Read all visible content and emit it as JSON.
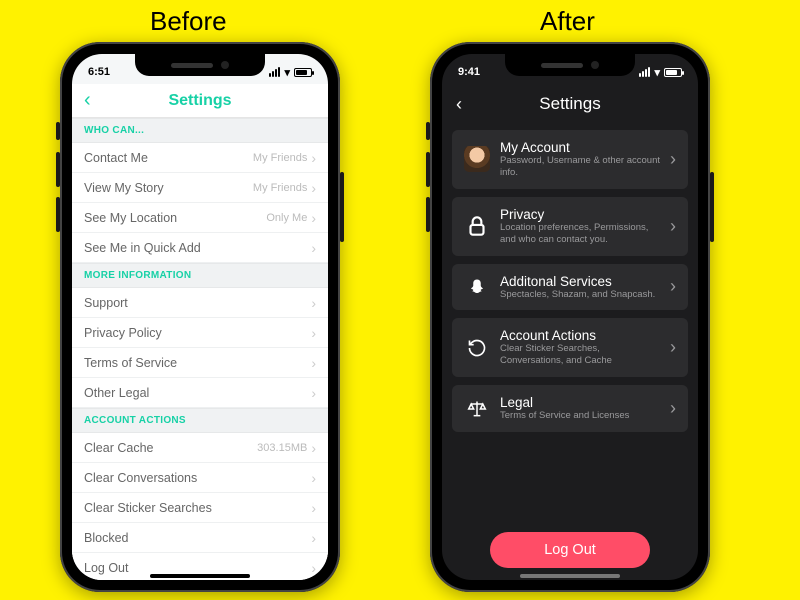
{
  "captions": {
    "before": "Before",
    "after": "After"
  },
  "before": {
    "status": {
      "time": "6:51"
    },
    "header": {
      "title": "Settings"
    },
    "sections": {
      "who_can": {
        "header": "WHO CAN...",
        "items": [
          {
            "label": "Contact Me",
            "value": "My Friends"
          },
          {
            "label": "View My Story",
            "value": "My Friends"
          },
          {
            "label": "See My Location",
            "value": "Only Me"
          },
          {
            "label": "See Me in Quick Add",
            "value": ""
          }
        ]
      },
      "more_info": {
        "header": "MORE INFORMATION",
        "items": [
          {
            "label": "Support"
          },
          {
            "label": "Privacy Policy"
          },
          {
            "label": "Terms of Service"
          },
          {
            "label": "Other Legal"
          }
        ]
      },
      "account_actions": {
        "header": "ACCOUNT ACTIONS",
        "items": [
          {
            "label": "Clear Cache",
            "value": "303.15MB"
          },
          {
            "label": "Clear Conversations"
          },
          {
            "label": "Clear Sticker Searches"
          },
          {
            "label": "Blocked"
          },
          {
            "label": "Log Out"
          }
        ]
      }
    }
  },
  "after": {
    "status": {
      "time": "9:41"
    },
    "header": {
      "title": "Settings"
    },
    "items": [
      {
        "icon": "avatar-icon",
        "title": "My Account",
        "subtitle": "Password, Username & other account info."
      },
      {
        "icon": "lock-icon",
        "title": "Privacy",
        "subtitle": "Location preferences, Permissions, and who can contact you."
      },
      {
        "icon": "ghost-icon",
        "title": "Additonal Services",
        "subtitle": "Spectacles, Shazam, and Snapcash."
      },
      {
        "icon": "reload-icon",
        "title": "Account Actions",
        "subtitle": "Clear Sticker Searches, Conversations, and Cache"
      },
      {
        "icon": "scales-icon",
        "title": "Legal",
        "subtitle": "Terms of Service and Licenses"
      }
    ],
    "logout": "Log Out"
  }
}
